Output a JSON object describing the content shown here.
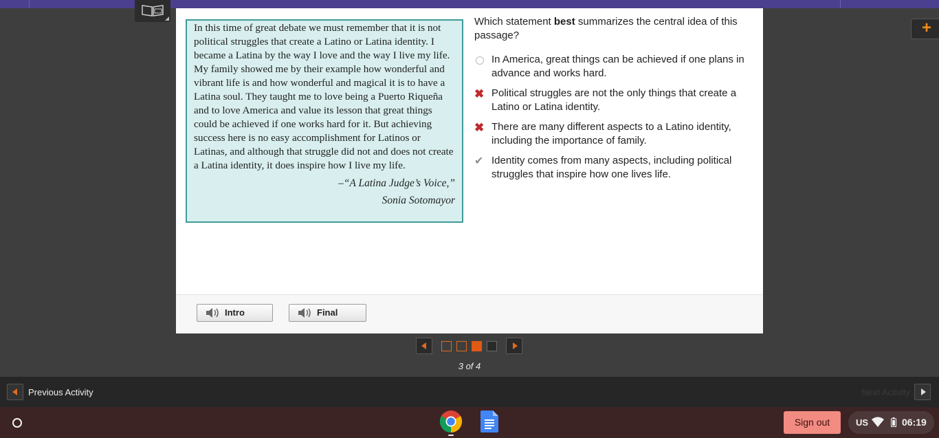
{
  "passage": {
    "text": "In this time of great debate we must remember that it is not political struggles that create a Latino or Latina identity. I became a Latina by the way I love and the way I live my life. My family showed me by their example how wonderful and vibrant life is and how wonderful and magical it is to have a Latina soul. They taught me to love being a Puerto Riqueña and to love America and value its lesson that great things could be achieved if one works hard for it. But achieving success here is no easy accomplishment for Latinos or Latinas, and although that struggle did not and does not create a Latina identity, it does inspire how I live my life.",
    "citation_title": "–“A Latina Judge’s Voice,”",
    "citation_author": "Sonia Sotomayor"
  },
  "question": {
    "prefix": "Which statement ",
    "bold": "best",
    "suffix": " summarizes the central idea of this passage?"
  },
  "options": [
    {
      "text": "In America, great things can be achieved if one plans in advance and works hard.",
      "state": "unanswered",
      "icon": "radio-empty-icon"
    },
    {
      "text": "Political struggles are not the only things that create a Latino or Latina identity.",
      "state": "incorrect",
      "icon": "x-mark-icon"
    },
    {
      "text": "There are many different aspects to a Latino identity, including the importance of family.",
      "state": "incorrect",
      "icon": "x-mark-icon"
    },
    {
      "text": "Identity comes from many aspects, including political struggles that inspire how one lives life.",
      "state": "correct",
      "icon": "check-mark-icon"
    }
  ],
  "audio_buttons": [
    {
      "label": "Intro",
      "icon": "speaker-icon"
    },
    {
      "label": "Final",
      "icon": "speaker-icon"
    }
  ],
  "pager": {
    "current": 3,
    "total": 4,
    "label": "3 of 4",
    "pages": [
      "done",
      "done",
      "current",
      "todo"
    ]
  },
  "activity_nav": {
    "previous": "Previous Activity",
    "next": "Next Activity"
  },
  "shelf": {
    "sign_out": "Sign out",
    "ime": "US",
    "time": "06:19"
  },
  "colors": {
    "accent_orange": "#e05a14",
    "passage_bg": "#d9efef",
    "passage_border": "#3f9a9a",
    "incorrect": "#c0282c",
    "top_bar": "#4b3f8f",
    "sign_out_bg": "#f28b82"
  }
}
